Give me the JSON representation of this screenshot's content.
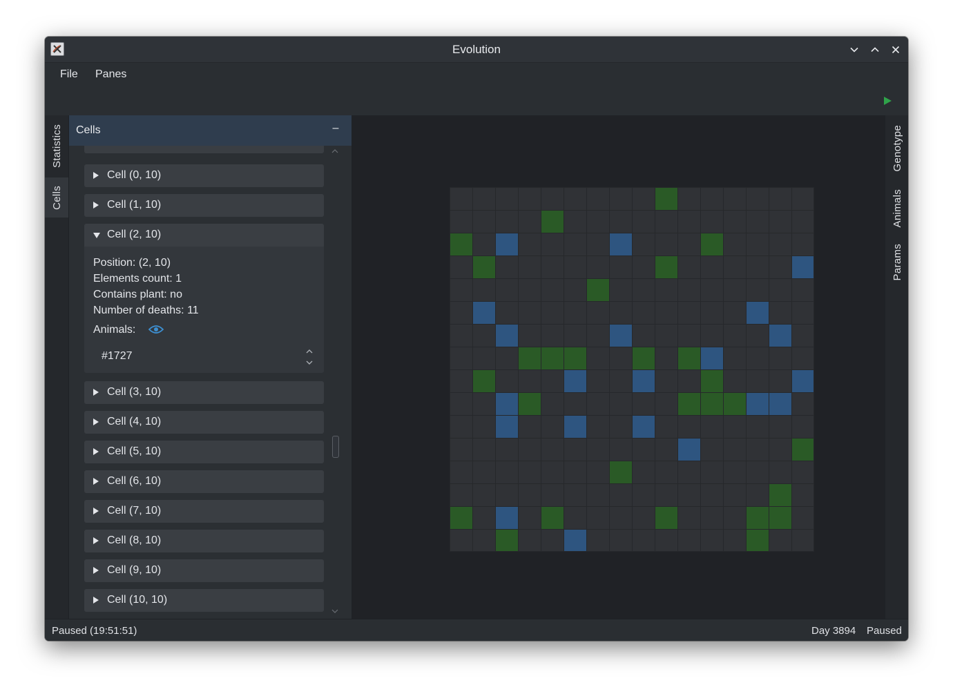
{
  "window": {
    "title": "Evolution"
  },
  "menu": {
    "items": [
      "File",
      "Panes"
    ]
  },
  "toolbar": {
    "play_icon": "play-icon",
    "play_color": "#2fa34a"
  },
  "left_tabs": [
    "Statistics",
    "Cells"
  ],
  "right_tabs": [
    "Genotype",
    "Animals",
    "Params"
  ],
  "panel": {
    "title": "Cells",
    "minimize": "–",
    "cells_before": [
      "Cell (0, 10)",
      "Cell (1, 10)"
    ],
    "expanded": {
      "label": "Cell (2, 10)",
      "position": "Position: (2, 10)",
      "elements": "Elements count: 1",
      "plant": "Contains plant: no",
      "deaths": "Number of deaths: 11",
      "animals_label": "Animals:",
      "animals": [
        "#1727"
      ]
    },
    "cells_after": [
      "Cell (3, 10)",
      "Cell (4, 10)",
      "Cell (5, 10)",
      "Cell (6, 10)",
      "Cell (7, 10)",
      "Cell (8, 10)",
      "Cell (9, 10)",
      "Cell (10, 10)"
    ]
  },
  "grid": {
    "columns": 16,
    "rows": 16,
    "colors": {
      "plant": "#2a5a26",
      "animal": "#2e5580",
      "empty": "#303236"
    },
    "plants": [
      [
        9,
        0
      ],
      [
        4,
        1
      ],
      [
        0,
        2
      ],
      [
        11,
        2
      ],
      [
        1,
        3
      ],
      [
        9,
        3
      ],
      [
        6,
        4
      ],
      [
        3,
        7
      ],
      [
        4,
        7
      ],
      [
        5,
        7
      ],
      [
        8,
        7
      ],
      [
        10,
        7
      ],
      [
        1,
        8
      ],
      [
        11,
        8
      ],
      [
        3,
        9
      ],
      [
        10,
        9
      ],
      [
        11,
        9
      ],
      [
        12,
        9
      ],
      [
        15,
        11
      ],
      [
        7,
        12
      ],
      [
        14,
        13
      ],
      [
        0,
        14
      ],
      [
        4,
        14
      ],
      [
        9,
        14
      ],
      [
        13,
        14
      ],
      [
        14,
        14
      ],
      [
        2,
        15
      ],
      [
        13,
        15
      ]
    ],
    "animals": [
      [
        2,
        2
      ],
      [
        7,
        2
      ],
      [
        15,
        3
      ],
      [
        1,
        5
      ],
      [
        13,
        5
      ],
      [
        2,
        6
      ],
      [
        7,
        6
      ],
      [
        14,
        6
      ],
      [
        11,
        7
      ],
      [
        5,
        8
      ],
      [
        8,
        8
      ],
      [
        15,
        8
      ],
      [
        2,
        9
      ],
      [
        13,
        9
      ],
      [
        14,
        9
      ],
      [
        2,
        10
      ],
      [
        5,
        10
      ],
      [
        8,
        10
      ],
      [
        10,
        11
      ],
      [
        2,
        14
      ],
      [
        5,
        15
      ]
    ]
  },
  "status": {
    "left": "Paused (19:51:51)",
    "day": "Day 3894",
    "right": "Paused"
  }
}
